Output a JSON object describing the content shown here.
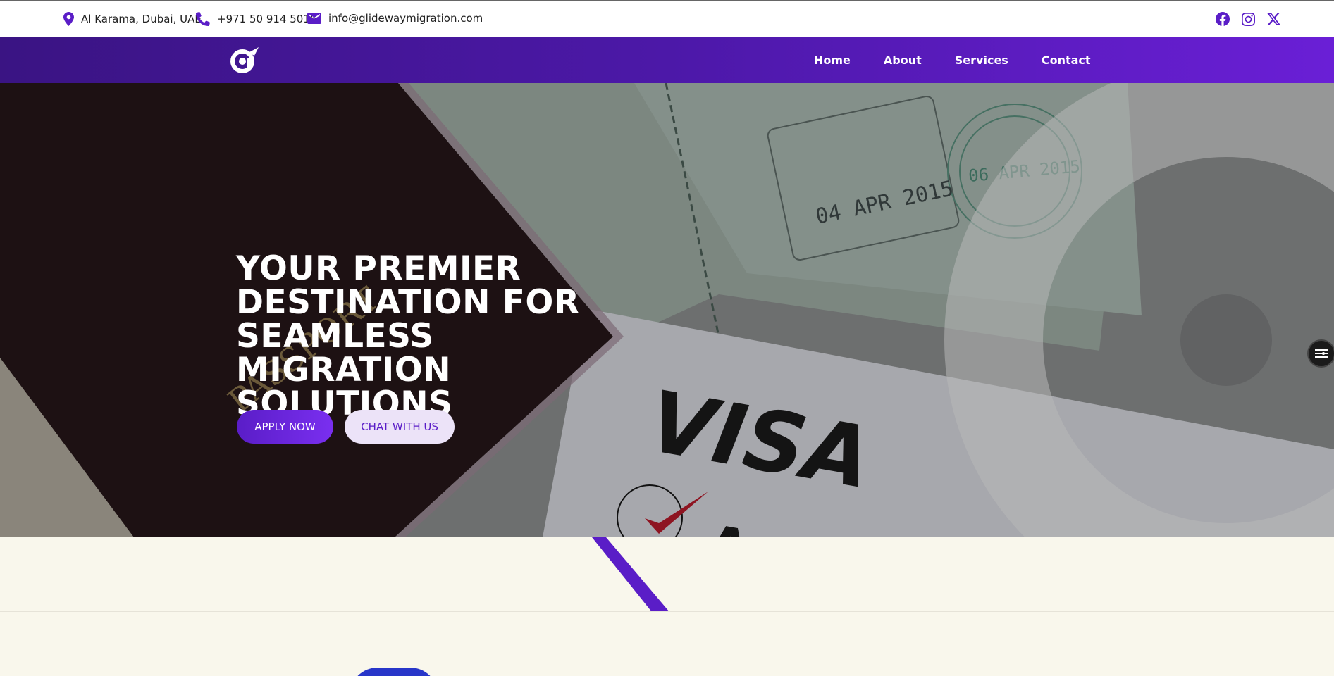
{
  "topbar": {
    "address": "Al Karama, Dubai, UAE",
    "phone": "+971 50 914 5016",
    "email": "info@glidewaymigration.com",
    "icons": [
      "map-pin-icon",
      "phone-icon",
      "envelope-icon",
      "facebook-icon",
      "instagram-icon",
      "x-icon"
    ]
  },
  "nav": {
    "items": [
      {
        "label": "Home"
      },
      {
        "label": "About"
      },
      {
        "label": "Services"
      },
      {
        "label": "Contact"
      }
    ]
  },
  "hero": {
    "title_lines": [
      "YOUR PREMIER",
      "DESTINATION FOR",
      "SEAMLESS MIGRATION",
      "SOLUTIONS"
    ],
    "apply_label": "APPLY NOW",
    "chat_label": "CHAT WITH US",
    "image_text": {
      "visa": "VISA",
      "approve": "Approve",
      "stamp_date_1": "04 APR 2015",
      "stamp_date_2": "06 APR 2015"
    }
  },
  "colors": {
    "brand_purple": "#5a1dc7",
    "nav_gradient_start": "#3a1483",
    "nav_gradient_end": "#6a1fd6",
    "page_background": "#f9f7ec"
  }
}
